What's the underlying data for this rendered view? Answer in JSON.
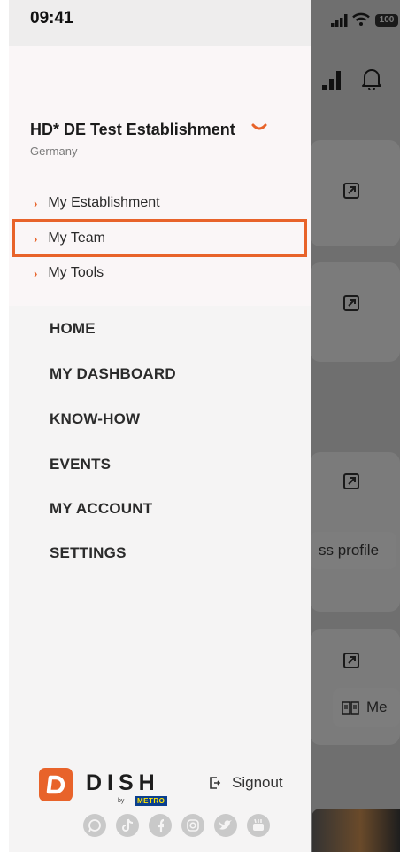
{
  "status_bar": {
    "time": "09:41",
    "battery": "100"
  },
  "establishment": {
    "name": "HD* DE Test Establishment",
    "country": "Germany"
  },
  "sub_menu": [
    {
      "label": "My Establishment"
    },
    {
      "label": "My Team",
      "highlighted": true
    },
    {
      "label": "My Tools"
    }
  ],
  "nav": [
    {
      "label": "HOME"
    },
    {
      "label": "MY DASHBOARD"
    },
    {
      "label": "KNOW-HOW"
    },
    {
      "label": "EVENTS"
    },
    {
      "label": "MY ACCOUNT"
    },
    {
      "label": "SETTINGS"
    }
  ],
  "footer": {
    "brand": "DISH",
    "by": "by",
    "metro": "METRO",
    "signout": "Signout",
    "social_icons": [
      "whatsapp-icon",
      "tiktok-icon",
      "facebook-icon",
      "instagram-icon",
      "twitter-icon",
      "youtube-icon"
    ]
  },
  "background": {
    "profile_pill": "ss profile",
    "menu_pill": "Me"
  },
  "colors": {
    "accent": "#e8632a",
    "drawer_bg": "#f5f4f4",
    "drawer_header_bg": "#faf6f7",
    "overlay": "#6f6f6f"
  }
}
